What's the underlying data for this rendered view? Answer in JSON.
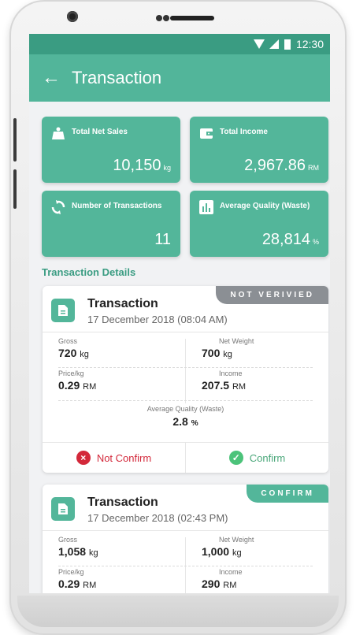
{
  "status": {
    "time": "12:30"
  },
  "appbar": {
    "title": "Transaction"
  },
  "stats": [
    {
      "label": "Total Net Sales",
      "value": "10,150",
      "unit": "kg"
    },
    {
      "label": "Total Income",
      "value": "2,967.86",
      "unit": "RM"
    },
    {
      "label": "Number of Transactions",
      "value": "11",
      "unit": ""
    },
    {
      "label": "Average Quality (Waste)",
      "value": "28,814",
      "unit": "%"
    }
  ],
  "section": {
    "title": "Transaction Details"
  },
  "cards": [
    {
      "badge": "NOT VERIVIED",
      "title": "Transaction",
      "date": "17 December 2018 (08:04 AM)",
      "gross_label": "Gross",
      "gross_value": "720",
      "gross_unit": "kg",
      "net_label": "Net Weight",
      "net_value": "700",
      "net_unit": "kg",
      "price_label": "Price/kg",
      "price_value": "0.29",
      "price_unit": "RM",
      "income_label": "Income",
      "income_value": "207.5",
      "income_unit": "RM",
      "avg_label": "Average Quality (Waste)",
      "avg_value": "2.8",
      "avg_unit": "%",
      "not_confirm": "Not Confirm",
      "confirm": "Confirm"
    },
    {
      "badge": "CONFIRM",
      "title": "Transaction",
      "date": "17 December 2018 (02:43 PM)",
      "gross_label": "Gross",
      "gross_value": "1,058",
      "gross_unit": "kg",
      "net_label": "Net Weight",
      "net_value": "1,000",
      "net_unit": "kg",
      "price_label": "Price/kg",
      "price_value": "0.29",
      "price_unit": "RM",
      "income_label": "Income",
      "income_value": "290",
      "income_unit": "RM"
    }
  ],
  "colors": {
    "primary": "#53b69a",
    "statusbar": "#3a9c82",
    "badge_grey": "#8b8f94",
    "danger": "#d3283a",
    "success": "#4cc37a"
  },
  "icons": [
    "back-arrow-icon",
    "scale-weight-icon",
    "wallet-icon",
    "refresh-icon",
    "bar-chart-icon",
    "document-icon",
    "close-circle-icon",
    "check-circle-icon",
    "wifi-icon",
    "signal-icon",
    "battery-icon"
  ]
}
